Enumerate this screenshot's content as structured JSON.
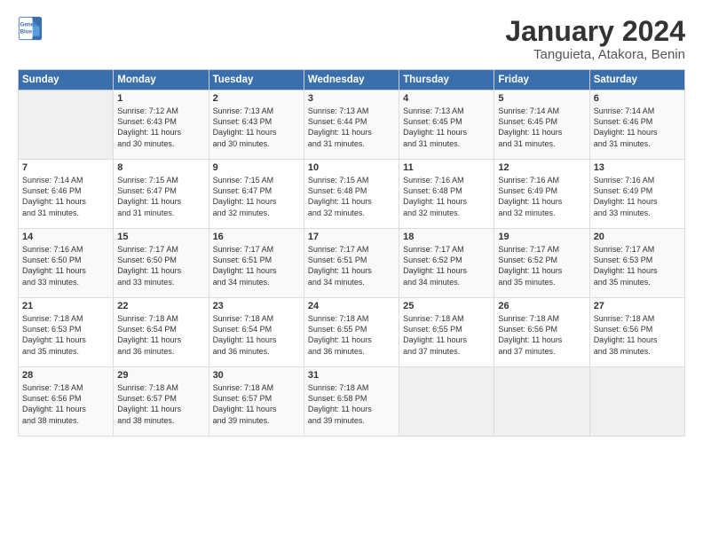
{
  "header": {
    "logo_line1": "General",
    "logo_line2": "Blue",
    "title": "January 2024",
    "subtitle": "Tanguieta, Atakora, Benin"
  },
  "weekdays": [
    "Sunday",
    "Monday",
    "Tuesday",
    "Wednesday",
    "Thursday",
    "Friday",
    "Saturday"
  ],
  "weeks": [
    [
      {
        "day": "",
        "text": ""
      },
      {
        "day": "1",
        "text": "Sunrise: 7:12 AM\nSunset: 6:43 PM\nDaylight: 11 hours\nand 30 minutes."
      },
      {
        "day": "2",
        "text": "Sunrise: 7:13 AM\nSunset: 6:43 PM\nDaylight: 11 hours\nand 30 minutes."
      },
      {
        "day": "3",
        "text": "Sunrise: 7:13 AM\nSunset: 6:44 PM\nDaylight: 11 hours\nand 31 minutes."
      },
      {
        "day": "4",
        "text": "Sunrise: 7:13 AM\nSunset: 6:45 PM\nDaylight: 11 hours\nand 31 minutes."
      },
      {
        "day": "5",
        "text": "Sunrise: 7:14 AM\nSunset: 6:45 PM\nDaylight: 11 hours\nand 31 minutes."
      },
      {
        "day": "6",
        "text": "Sunrise: 7:14 AM\nSunset: 6:46 PM\nDaylight: 11 hours\nand 31 minutes."
      }
    ],
    [
      {
        "day": "7",
        "text": "Sunrise: 7:14 AM\nSunset: 6:46 PM\nDaylight: 11 hours\nand 31 minutes."
      },
      {
        "day": "8",
        "text": "Sunrise: 7:15 AM\nSunset: 6:47 PM\nDaylight: 11 hours\nand 31 minutes."
      },
      {
        "day": "9",
        "text": "Sunrise: 7:15 AM\nSunset: 6:47 PM\nDaylight: 11 hours\nand 32 minutes."
      },
      {
        "day": "10",
        "text": "Sunrise: 7:15 AM\nSunset: 6:48 PM\nDaylight: 11 hours\nand 32 minutes."
      },
      {
        "day": "11",
        "text": "Sunrise: 7:16 AM\nSunset: 6:48 PM\nDaylight: 11 hours\nand 32 minutes."
      },
      {
        "day": "12",
        "text": "Sunrise: 7:16 AM\nSunset: 6:49 PM\nDaylight: 11 hours\nand 32 minutes."
      },
      {
        "day": "13",
        "text": "Sunrise: 7:16 AM\nSunset: 6:49 PM\nDaylight: 11 hours\nand 33 minutes."
      }
    ],
    [
      {
        "day": "14",
        "text": "Sunrise: 7:16 AM\nSunset: 6:50 PM\nDaylight: 11 hours\nand 33 minutes."
      },
      {
        "day": "15",
        "text": "Sunrise: 7:17 AM\nSunset: 6:50 PM\nDaylight: 11 hours\nand 33 minutes."
      },
      {
        "day": "16",
        "text": "Sunrise: 7:17 AM\nSunset: 6:51 PM\nDaylight: 11 hours\nand 34 minutes."
      },
      {
        "day": "17",
        "text": "Sunrise: 7:17 AM\nSunset: 6:51 PM\nDaylight: 11 hours\nand 34 minutes."
      },
      {
        "day": "18",
        "text": "Sunrise: 7:17 AM\nSunset: 6:52 PM\nDaylight: 11 hours\nand 34 minutes."
      },
      {
        "day": "19",
        "text": "Sunrise: 7:17 AM\nSunset: 6:52 PM\nDaylight: 11 hours\nand 35 minutes."
      },
      {
        "day": "20",
        "text": "Sunrise: 7:17 AM\nSunset: 6:53 PM\nDaylight: 11 hours\nand 35 minutes."
      }
    ],
    [
      {
        "day": "21",
        "text": "Sunrise: 7:18 AM\nSunset: 6:53 PM\nDaylight: 11 hours\nand 35 minutes."
      },
      {
        "day": "22",
        "text": "Sunrise: 7:18 AM\nSunset: 6:54 PM\nDaylight: 11 hours\nand 36 minutes."
      },
      {
        "day": "23",
        "text": "Sunrise: 7:18 AM\nSunset: 6:54 PM\nDaylight: 11 hours\nand 36 minutes."
      },
      {
        "day": "24",
        "text": "Sunrise: 7:18 AM\nSunset: 6:55 PM\nDaylight: 11 hours\nand 36 minutes."
      },
      {
        "day": "25",
        "text": "Sunrise: 7:18 AM\nSunset: 6:55 PM\nDaylight: 11 hours\nand 37 minutes."
      },
      {
        "day": "26",
        "text": "Sunrise: 7:18 AM\nSunset: 6:56 PM\nDaylight: 11 hours\nand 37 minutes."
      },
      {
        "day": "27",
        "text": "Sunrise: 7:18 AM\nSunset: 6:56 PM\nDaylight: 11 hours\nand 38 minutes."
      }
    ],
    [
      {
        "day": "28",
        "text": "Sunrise: 7:18 AM\nSunset: 6:56 PM\nDaylight: 11 hours\nand 38 minutes."
      },
      {
        "day": "29",
        "text": "Sunrise: 7:18 AM\nSunset: 6:57 PM\nDaylight: 11 hours\nand 38 minutes."
      },
      {
        "day": "30",
        "text": "Sunrise: 7:18 AM\nSunset: 6:57 PM\nDaylight: 11 hours\nand 39 minutes."
      },
      {
        "day": "31",
        "text": "Sunrise: 7:18 AM\nSunset: 6:58 PM\nDaylight: 11 hours\nand 39 minutes."
      },
      {
        "day": "",
        "text": ""
      },
      {
        "day": "",
        "text": ""
      },
      {
        "day": "",
        "text": ""
      }
    ]
  ]
}
